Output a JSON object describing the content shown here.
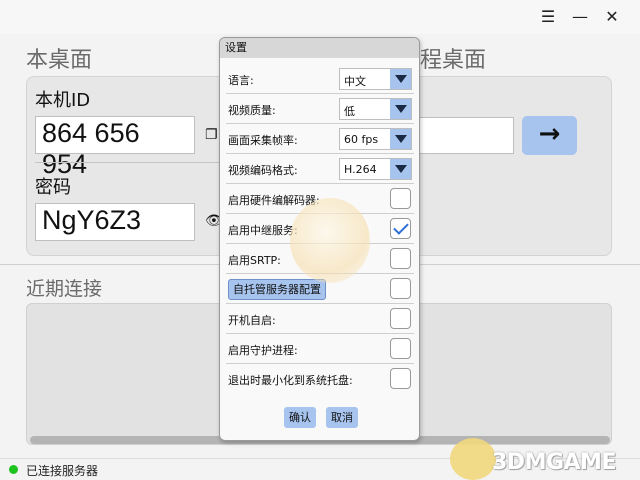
{
  "window": {
    "menu_icon": "menu-icon",
    "minimize_icon": "minimize-icon",
    "close_icon": "close-icon"
  },
  "local": {
    "title": "本桌面",
    "id_label": "本机ID",
    "id_value": "864 656 954",
    "password_label": "密码",
    "password_value": "NgY6Z3",
    "copy_icon": "copy-icon",
    "eye_icon": "eye-icon"
  },
  "remote": {
    "title": "程桌面",
    "input_value": "",
    "go_icon": "arrow-right-icon",
    "go_symbol": "→"
  },
  "recent": {
    "title": "近期连接"
  },
  "status": {
    "text": "已连接服务器",
    "color": "#1ec31e"
  },
  "settings": {
    "title": "设置",
    "selects": [
      {
        "label": "语言:",
        "value": "中文"
      },
      {
        "label": "视频质量:",
        "value": "低"
      },
      {
        "label": "画面采集帧率:",
        "value": "60 fps"
      },
      {
        "label": "视频编码格式:",
        "value": "H.264"
      }
    ],
    "toggles": [
      {
        "label": "启用硬件编解码器:",
        "checked": false
      },
      {
        "label": "启用中继服务:",
        "checked": true
      },
      {
        "label": "启用SRTP:",
        "checked": false
      }
    ],
    "config_button": "自托管服务器配置",
    "toggles2": [
      {
        "label": "开机自启:",
        "checked": false
      },
      {
        "label": "启用守护进程:",
        "checked": false
      },
      {
        "label": "退出时最小化到系统托盘:",
        "checked": false
      }
    ],
    "ok": "确认",
    "cancel": "取消"
  },
  "watermark": {
    "text": "3DMGAME"
  },
  "colors": {
    "accent": "#a7c4ee",
    "status_green": "#1ec31e"
  }
}
